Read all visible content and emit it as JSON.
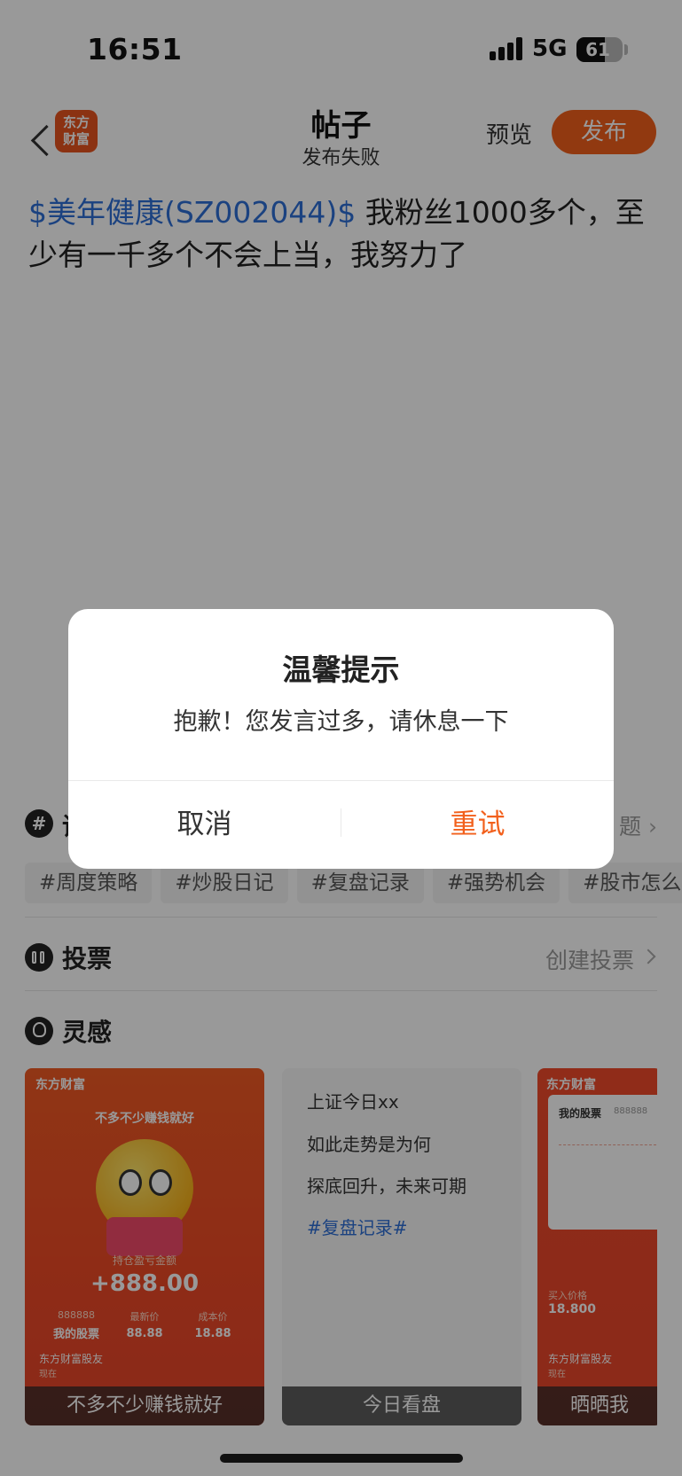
{
  "status_bar": {
    "time": "16:51",
    "network": "5G",
    "battery": "61",
    "battery_level": 0.61
  },
  "nav": {
    "logo_line1": "东方",
    "logo_line2": "财富",
    "title": "帖子",
    "subtitle": "发布失败",
    "preview": "预览",
    "publish": "发布"
  },
  "post": {
    "stock_tag": "$美年健康(SZ002044)$",
    "body": " 我粉丝1000多个，至少有一千多个不会上当，我努力了"
  },
  "topics": {
    "title_glyph": "话",
    "more_glyph": "题",
    "tags": [
      "#周度策略",
      "#炒股日记",
      "#复盘记录",
      "#强势机会",
      "#股市怎么"
    ]
  },
  "vote": {
    "title": "投票",
    "create": "创建投票"
  },
  "inspiration": {
    "title": "灵感",
    "cards": [
      {
        "brand": "东方财富",
        "slogan": "不多不少赚钱就好",
        "label": "持仓盈亏金额",
        "amount": "+888.00",
        "stock_code": "888888",
        "stock_name": "我的股票",
        "latest_label": "最新价",
        "latest_value": "88.88",
        "cost_label": "成本价",
        "cost_value": "18.88",
        "footer_name": "东方财富股友",
        "footer_time": "现在",
        "caption": "不多不少赚钱就好"
      },
      {
        "lines": [
          "上证今日xx",
          "如此走势是为何",
          "探底回升，未来可期"
        ],
        "tag": "#复盘记录#",
        "caption": "今日看盘"
      },
      {
        "brand": "东方财富",
        "panel_title": "我的股票",
        "panel_code": "888888",
        "buy_label": "买入价格",
        "buy_value": "18.800",
        "footer_name": "东方财富股友",
        "footer_time": "现在",
        "caption": "晒晒我"
      }
    ]
  },
  "dialog": {
    "title": "温馨提示",
    "message": "抱歉！您发言过多，请休息一下",
    "cancel": "取消",
    "retry": "重试"
  }
}
